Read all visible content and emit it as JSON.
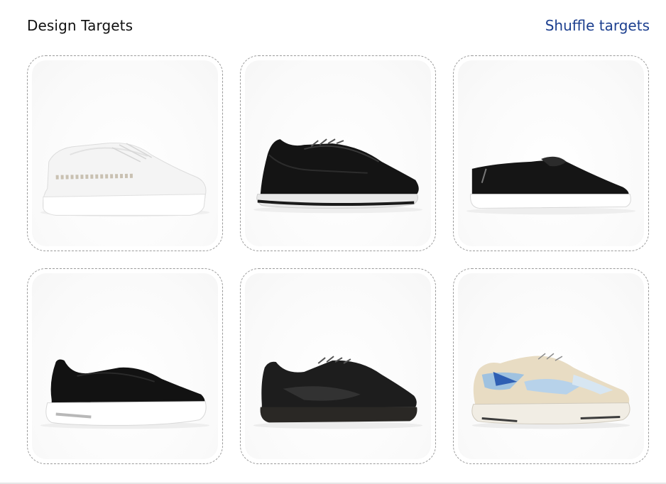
{
  "header": {
    "title": "Design Targets",
    "shuffle_label": "Shuffle targets"
  },
  "colors": {
    "link": "#1c3f8f",
    "card_border": "#9b9b9b"
  },
  "cards": [
    {
      "icon": "white-sneaker-image"
    },
    {
      "icon": "black-running-sneaker-image"
    },
    {
      "icon": "black-canvas-sneaker-image"
    },
    {
      "icon": "black-slip-on-sneaker-image"
    },
    {
      "icon": "black-leather-sneaker-image"
    },
    {
      "icon": "beige-blue-chunky-sneaker-image"
    }
  ]
}
